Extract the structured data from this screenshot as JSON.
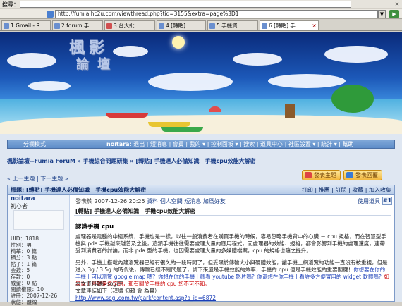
{
  "browser": {
    "search_label": "搜尋：",
    "url": "http://fumia.hc2u.com/viewthread.php?tid=3155&extra=page%3D1",
    "close_glyph": "×",
    "dropdown_glyph": "▼",
    "go_glyph": "▶",
    "tabs": [
      {
        "label": "1.Gmail - R..."
      },
      {
        "label": "2.forum 手..."
      },
      {
        "label": "3.台大批..."
      },
      {
        "label": "4.[轉貼]..."
      },
      {
        "label": "5.手機資..."
      },
      {
        "label": "6.[轉貼] 手..."
      }
    ]
  },
  "banner": {
    "logo_top": "楓影",
    "logo_bottom": "論壇"
  },
  "nav": {
    "left": "分欄模式",
    "user": "noitara:",
    "links": "退出 | 短消息 | 會員 | 我的 ▾ | 控制面板 ▾ | 搜索 | 道具中心 | 社區設置 ▾ | 統計 ▾ | 幫助"
  },
  "breadcrumb": "楓影論壇--Fumia ForuM » 手機綜合問題研集 » [轉貼] 手機達人必備知識　手機cpu效能大解密",
  "pager": "« 上一主題 | 下一主題 »",
  "buttons": {
    "new_topic": "發表主題",
    "reply": "發表回覆"
  },
  "thread": {
    "title": "標題: [轉貼] 手機達人必備知識　手機cpu效能大解密",
    "ops": "打印 | 推薦 | 訂閱 | 收藏 | 加入收集"
  },
  "user": {
    "name": "noitara",
    "rank": "初心者",
    "stats": [
      "UID：1818",
      "性別：男",
      "精華：0 篇",
      "積分：3 點",
      "帖子：1 篇",
      "金錢：5",
      "存款：0",
      "威望：0 點",
      "閱讀權限：10",
      "註冊：2007-12-26",
      "狀態：離線"
    ]
  },
  "post": {
    "meta_pre": "發表於 2007-12-26 20:25",
    "meta_links": "資料  個人空間  短消息  加爲好友",
    "tools": "使用道具",
    "floor": "#1",
    "subject": "[轉貼] 手機達人必備知識　手機cpu效能大解密",
    "title": "認識手機 cpu",
    "p1": "處理器是電腦的中樞系統，手機也是一樣，以往一般消費者在購買手機的時候，容易忽略手機背中的心臟 － cpu 規格，而在智慧型手機與 pda 手機越來越普及之後，這類手機往往需要處理大量的應用程式，而處理器的效能、規格，都會影響到手機的處理速度，連帶受到消費者的討論，而非 pda 型的手機，也因需要處理大量的多媒體檔案，cpu 的規格也隨之提升。",
    "p2a": "另外，手機上搭載內建瀏覽器已經有很久的一段時間了，但受限於傳輸大小與硬體效能，讓手機上網瀏覽的功能一直沒有被重視，但是進入 3g / 3.5g 的時代後，傳輸已經不是問題了，請下來還是手機效能的效率，手機的 cpu 便是手機效能的重要關鍵！",
    "p2b": "你想要在你的手機上可以瀏覽 google map 嗎？你想在你的手機上觀看 youtube 影片嗎？你還想在你手機上看許多方便實用的 widget 軟體嗎？",
    "p2c": "如果以上答案是肯定的，那有關於手機的 cpu 您不可不知。",
    "p3": "本文資料轉自sogi王",
    "p4": "文章連結如下（拜讀 仰賴 會 為轟）",
    "p5": "http://www.sogi.com.tw/park/content.asp?a_id=6872"
  },
  "colors": {
    "nav_bg": "#5d8cc8",
    "link": "#1b3f88",
    "highlight_blue": "#1b3fb8",
    "highlight_red": "#c00000",
    "button_bg": "#f2b73f"
  }
}
